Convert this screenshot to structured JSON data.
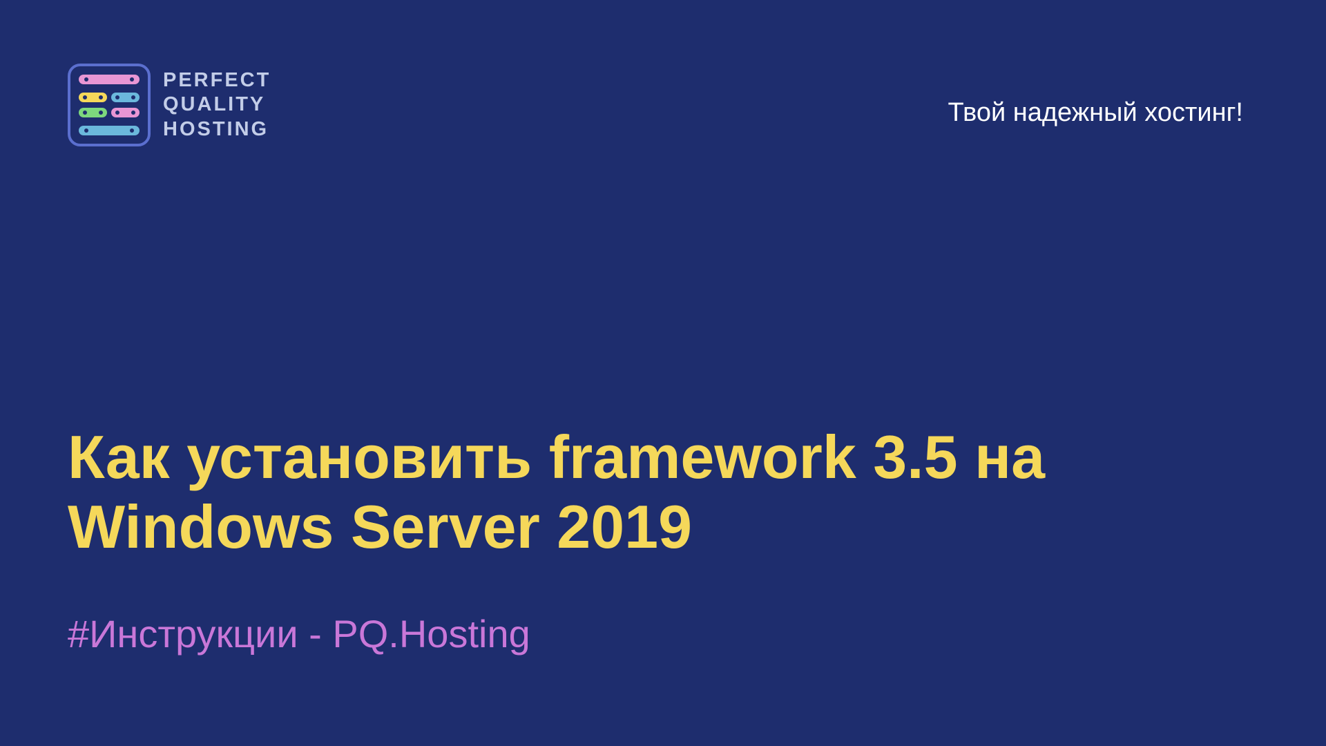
{
  "logo": {
    "line1": "PERFECT",
    "line2": "QUALITY",
    "line3": "HOSTING"
  },
  "tagline": "Твой надежный хостинг!",
  "title": "Как установить framework 3.5 на Windows Server 2019",
  "subtitle": "#Инструкции - PQ.Hosting",
  "colors": {
    "background": "#1e2d6e",
    "title": "#f5d85a",
    "subtitle": "#c977d8",
    "tagline": "#ffffff",
    "logoText": "#c3cde8"
  }
}
